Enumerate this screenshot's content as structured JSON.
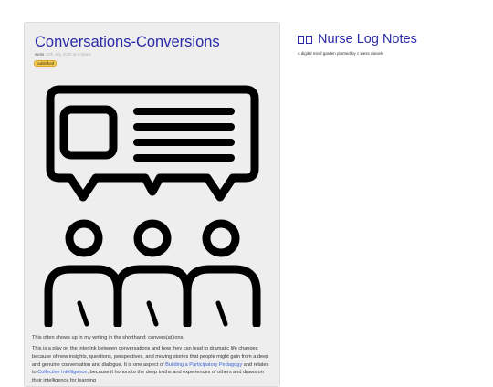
{
  "site": {
    "title": "Nurse Log Notes",
    "tagline": "a digital mind garden planted by c wess daniels"
  },
  "post": {
    "title": "Conversations-Conversions",
    "author": "wess",
    "date": "16th July 2025 at 6:49am",
    "status": "published",
    "illustration_icon": "people-conversation-icon",
    "paragraphs": {
      "p1": "This often shows up in my writing in the shorthand: convers(at)ions.",
      "p2_a": "This is a play on the interlink between conversations and how they can lead to dramatic life changes because of new insights, questions, perspectives, and moving stories that people might gain from a deep and genuine conversation and dialogue. It is one aspect of ",
      "p2_link1": "Building a Participatory Pedagogy",
      "p2_b": " and relates to ",
      "p2_link2": "Collective Intelligence",
      "p2_c": ", because it honors to the deep truths and experiences of others and draws on their intelligence for learning"
    }
  },
  "colors": {
    "title": "#2a2aa8",
    "link": "#3a66d6",
    "badge": "#f5cc55",
    "card": "#eeeeee"
  }
}
